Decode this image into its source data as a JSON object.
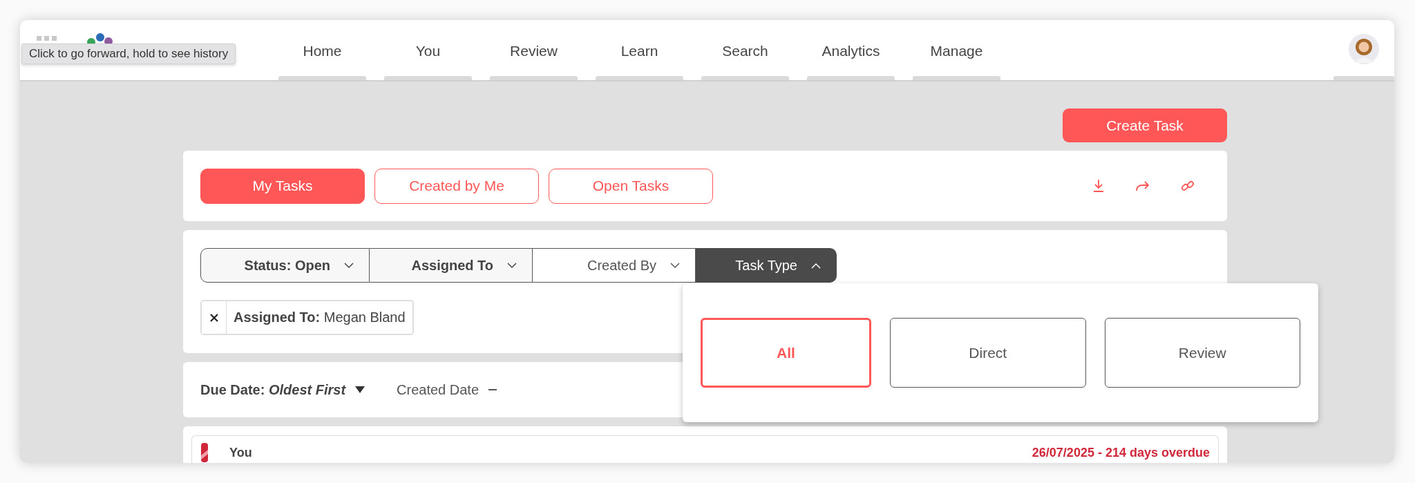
{
  "browser_tooltip": {
    "text": "Click to go forward, hold to see history"
  },
  "nav": {
    "items": [
      {
        "label": "Home",
        "selected": false
      },
      {
        "label": "You",
        "selected": false
      },
      {
        "label": "Review",
        "selected": false
      },
      {
        "label": "Learn",
        "selected": false
      },
      {
        "label": "Search",
        "selected": false
      },
      {
        "label": "Analytics",
        "selected": false
      },
      {
        "label": "Manage",
        "selected": false
      }
    ]
  },
  "create_button": "Create Task",
  "view_tabs": [
    {
      "label": "My Tasks",
      "selected": true
    },
    {
      "label": "Created by Me",
      "selected": false
    },
    {
      "label": "Open Tasks",
      "selected": false
    }
  ],
  "filters": [
    {
      "label": "Status: Open",
      "applied": true,
      "expanded": false
    },
    {
      "label": "Assigned To",
      "applied": true,
      "expanded": false
    },
    {
      "label": "Created By",
      "applied": false,
      "expanded": false
    },
    {
      "label": "Task Type",
      "applied": false,
      "expanded": true
    }
  ],
  "active_filters": [
    {
      "label": "Assigned To:",
      "value": "Megan Bland"
    }
  ],
  "task_type_options": [
    {
      "label": "All",
      "selected": true
    },
    {
      "label": "Direct",
      "selected": false
    },
    {
      "label": "Review",
      "selected": false
    }
  ],
  "sort": [
    {
      "label": "Due Date:",
      "value": "Oldest First",
      "active": true
    },
    {
      "label": "Created Date",
      "active": false
    }
  ],
  "tasks": [
    {
      "assignee": "You",
      "due": "26/07/2025 - 214 days overdue",
      "overdue": true
    }
  ]
}
